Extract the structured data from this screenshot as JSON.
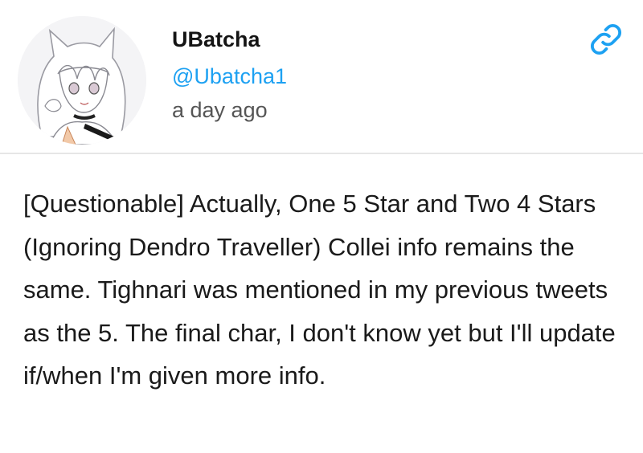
{
  "author": {
    "display_name": "UBatcha",
    "handle": "@Ubatcha1",
    "timestamp": "a day ago",
    "avatar_icon": "avatar-anime-character"
  },
  "actions": {
    "link_icon": "link-icon",
    "accent_color": "#1da1f2"
  },
  "post": {
    "text": "[Questionable] Actually, One 5 Star and Two 4 Stars (Ignoring Dendro Traveller) Collei info remains the same. Tighnari was mentioned in my previous tweets as the 5. The final char, I don't know yet but I'll update if/when I'm given more info."
  }
}
